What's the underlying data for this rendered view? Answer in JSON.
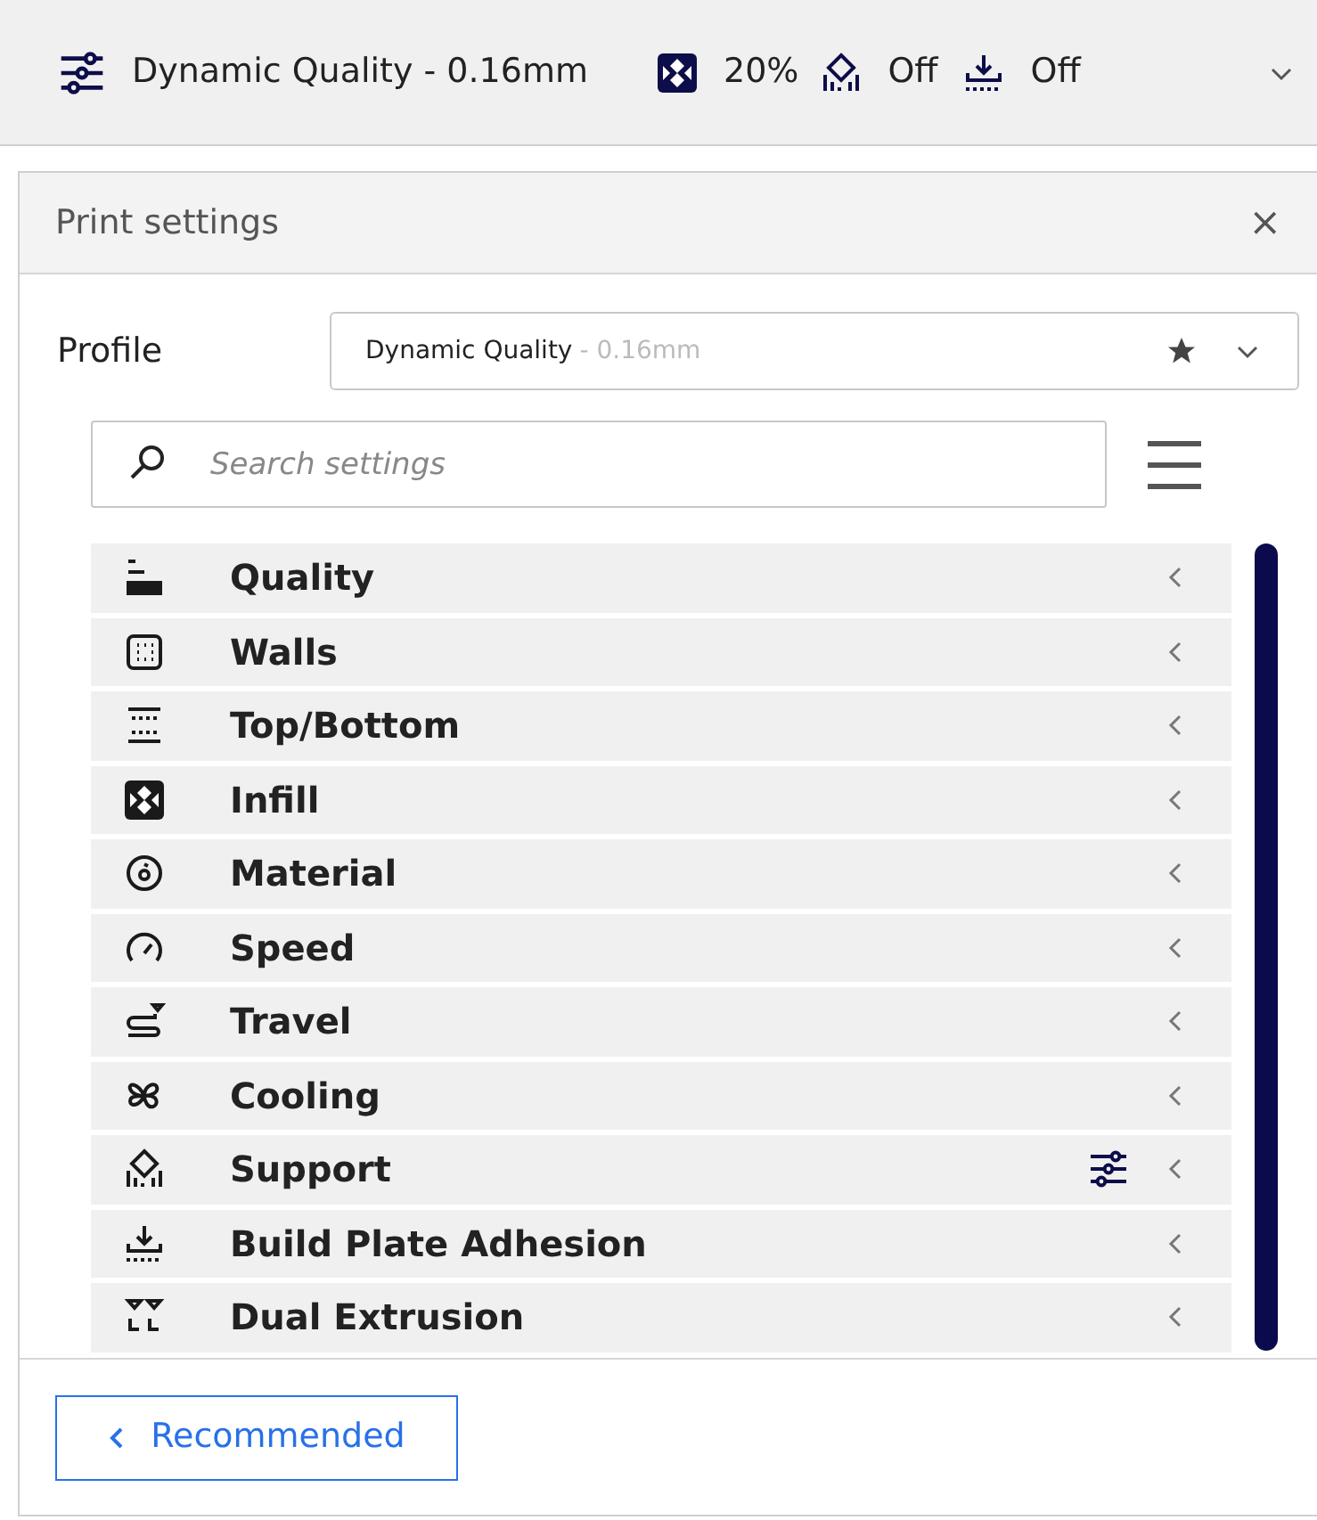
{
  "top_bar": {
    "profile": "Dynamic Quality - 0.16mm",
    "infill": "20%",
    "support": "Off",
    "adhesion": "Off"
  },
  "panel": {
    "title": "Print settings",
    "close": "×",
    "profile_label": "Profile",
    "profile_name": "Dynamic Quality",
    "profile_suffix": "- 0.16mm",
    "search": {
      "placeholder": "Search settings"
    },
    "categories": [
      {
        "label": "Quality",
        "customized": false
      },
      {
        "label": "Walls",
        "customized": false
      },
      {
        "label": "Top/Bottom",
        "customized": false
      },
      {
        "label": "Infill",
        "customized": false
      },
      {
        "label": "Material",
        "customized": false
      },
      {
        "label": "Speed",
        "customized": false
      },
      {
        "label": "Travel",
        "customized": false
      },
      {
        "label": "Cooling",
        "customized": false
      },
      {
        "label": "Support",
        "customized": true
      },
      {
        "label": "Build Plate Adhesion",
        "customized": false
      },
      {
        "label": "Dual Extrusion",
        "customized": false
      }
    ],
    "footer_button": "Recommended"
  }
}
